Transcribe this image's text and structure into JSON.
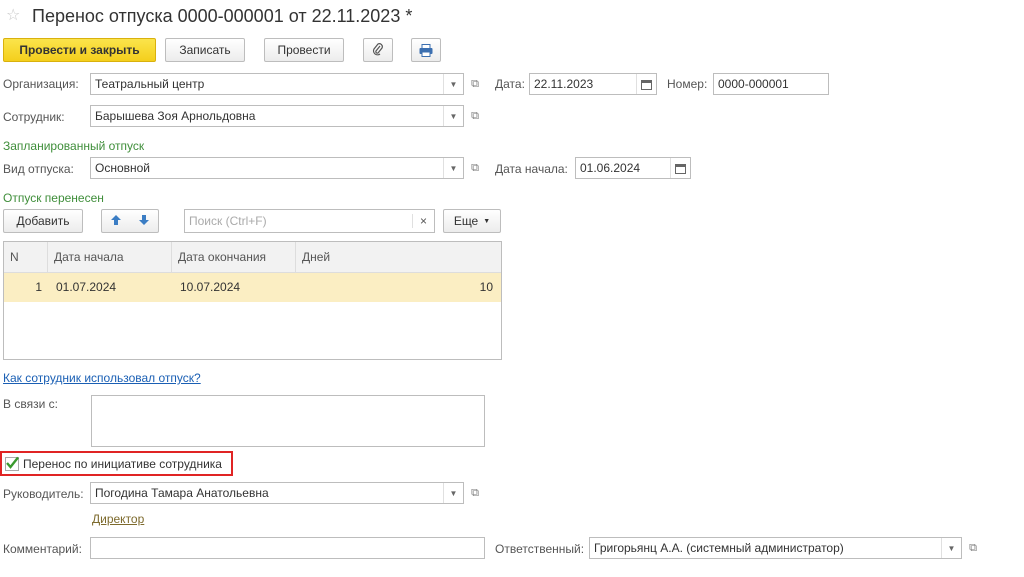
{
  "header": {
    "title": "Перенос отпуска 0000-000001 от 22.11.2023 *"
  },
  "toolbar": {
    "post_close_label": "Провести и закрыть",
    "save_label": "Записать",
    "post_label": "Провести"
  },
  "organization": {
    "label": "Организация:",
    "value": "Театральный центр"
  },
  "date": {
    "label": "Дата:",
    "value": "22.11.2023"
  },
  "number": {
    "label": "Номер:",
    "value": "0000-000001"
  },
  "employee": {
    "label": "Сотрудник:",
    "value": "Барышева Зоя Арнольдовна"
  },
  "planned": {
    "section_label": "Запланированный отпуск",
    "type_label": "Вид отпуска:",
    "type_value": "Основной",
    "start_label": "Дата начала:",
    "start_value": "01.06.2024"
  },
  "moved": {
    "section_label": "Отпуск перенесен",
    "add_label": "Добавить",
    "search_placeholder": "Поиск (Ctrl+F)",
    "more_label": "Еще",
    "columns": [
      "N",
      "Дата начала",
      "Дата окончания",
      "Дней"
    ],
    "rows": [
      {
        "n": "1",
        "start": "01.07.2024",
        "end": "10.07.2024",
        "days": "10"
      }
    ]
  },
  "usage_link": "Как сотрудник использовал отпуск?",
  "reason": {
    "label": "В связи с:",
    "value": ""
  },
  "employee_initiative": {
    "label": "Перенос по инициативе сотрудника",
    "checked": true
  },
  "manager": {
    "label": "Руководитель:",
    "value": "Погодина Тамара Анатольевна",
    "position_link": "Директор"
  },
  "comment": {
    "label": "Комментарий:",
    "value": ""
  },
  "responsible": {
    "label": "Ответственный:",
    "value": "Григорьянц А.А. (системный администратор)"
  },
  "colors": {
    "primary_button": "#f4cf1c",
    "section_green": "#3f8e3a",
    "selected_row": "#fbeec3",
    "highlight_border": "#e02424",
    "link": "#1a5fb4"
  }
}
